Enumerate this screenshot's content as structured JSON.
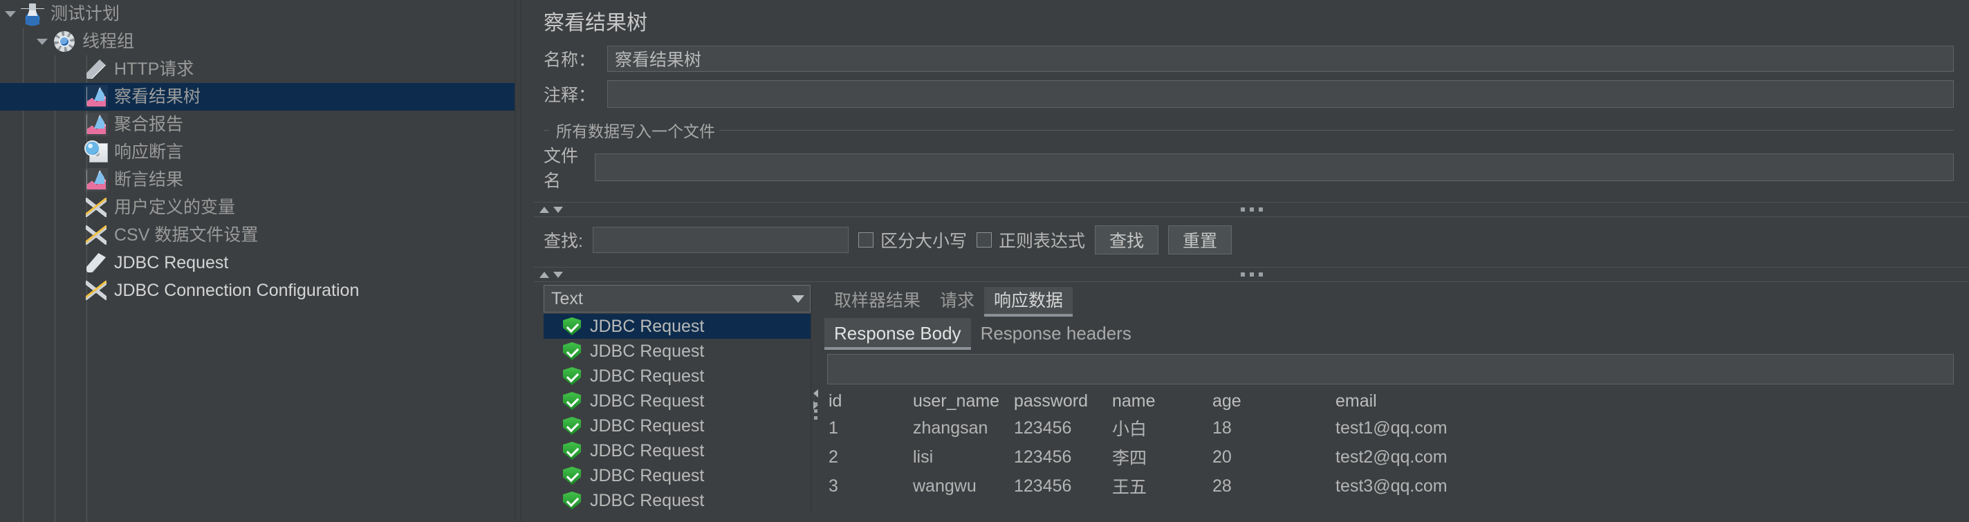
{
  "tree": {
    "items": [
      {
        "label": "测试计划",
        "icon": "flask-icon",
        "depth": 0,
        "twisty": "expanded",
        "selected": false,
        "bright": false
      },
      {
        "label": "线程组",
        "icon": "gear-icon",
        "depth": 1,
        "twisty": "expanded",
        "selected": false,
        "bright": false
      },
      {
        "label": "HTTP请求",
        "icon": "pencil-icon",
        "depth": 2,
        "twisty": "none",
        "selected": false,
        "bright": false
      },
      {
        "label": "察看结果树",
        "icon": "chart-icon",
        "depth": 2,
        "twisty": "none",
        "selected": true,
        "bright": false
      },
      {
        "label": "聚合报告",
        "icon": "chart-icon",
        "depth": 2,
        "twisty": "none",
        "selected": false,
        "bright": false
      },
      {
        "label": "响应断言",
        "icon": "magnifier-icon",
        "depth": 2,
        "twisty": "none",
        "selected": false,
        "bright": false
      },
      {
        "label": "断言结果",
        "icon": "chart-icon",
        "depth": 2,
        "twisty": "none",
        "selected": false,
        "bright": false
      },
      {
        "label": "用户定义的变量",
        "icon": "tools-icon",
        "depth": 2,
        "twisty": "none",
        "selected": false,
        "bright": false
      },
      {
        "label": "CSV 数据文件设置",
        "icon": "tools-icon",
        "depth": 2,
        "twisty": "none",
        "selected": false,
        "bright": false
      },
      {
        "label": "JDBC Request",
        "icon": "screwdriver-icon",
        "depth": 2,
        "twisty": "none",
        "selected": false,
        "bright": true
      },
      {
        "label": "JDBC Connection Configuration",
        "icon": "tools-icon",
        "depth": 2,
        "twisty": "none",
        "selected": false,
        "bright": true
      }
    ]
  },
  "panel": {
    "title": "察看结果树",
    "name_label": "名称：",
    "name_value": "察看结果树",
    "comment_label": "注释：",
    "comment_value": "",
    "file_group_title": "所有数据写入一个文件",
    "filename_label": "文件名",
    "filename_value": ""
  },
  "search": {
    "label": "查找:",
    "value": "",
    "case_sensitive_label": "区分大小写",
    "case_sensitive_checked": false,
    "regex_label": "正则表达式",
    "regex_checked": false,
    "find_button": "查找",
    "reset_button": "重置"
  },
  "results": {
    "render_selector": "Text",
    "items": [
      {
        "label": "JDBC Request",
        "status": "success",
        "selected": true
      },
      {
        "label": "JDBC Request",
        "status": "success",
        "selected": false
      },
      {
        "label": "JDBC Request",
        "status": "success",
        "selected": false
      },
      {
        "label": "JDBC Request",
        "status": "success",
        "selected": false
      },
      {
        "label": "JDBC Request",
        "status": "success",
        "selected": false
      },
      {
        "label": "JDBC Request",
        "status": "success",
        "selected": false
      },
      {
        "label": "JDBC Request",
        "status": "success",
        "selected": false
      },
      {
        "label": "JDBC Request",
        "status": "success",
        "selected": false
      }
    ]
  },
  "tabs": {
    "main": [
      {
        "label": "取样器结果",
        "active": false
      },
      {
        "label": "请求",
        "active": false
      },
      {
        "label": "响应数据",
        "active": true
      }
    ],
    "sub": [
      {
        "label": "Response Body",
        "active": true
      },
      {
        "label": "Response headers",
        "active": false
      }
    ]
  },
  "response": {
    "search_value": "",
    "table": {
      "headers": [
        "id",
        "user_name",
        "password",
        "name",
        "age",
        "email"
      ],
      "rows": [
        [
          "1",
          "zhangsan",
          "123456",
          "小白",
          "18",
          "test1@qq.com"
        ],
        [
          "2",
          "lisi",
          "123456",
          "李四",
          "20",
          "test2@qq.com"
        ],
        [
          "3",
          "wangwu",
          "123456",
          "王五",
          "28",
          "test3@qq.com"
        ]
      ]
    }
  },
  "colors": {
    "background": "#3c3f41",
    "selection": "#0d2c4d",
    "field": "#45494b",
    "border": "#5e6366",
    "text": "#b6b6b6",
    "success": "#2aa83a"
  }
}
